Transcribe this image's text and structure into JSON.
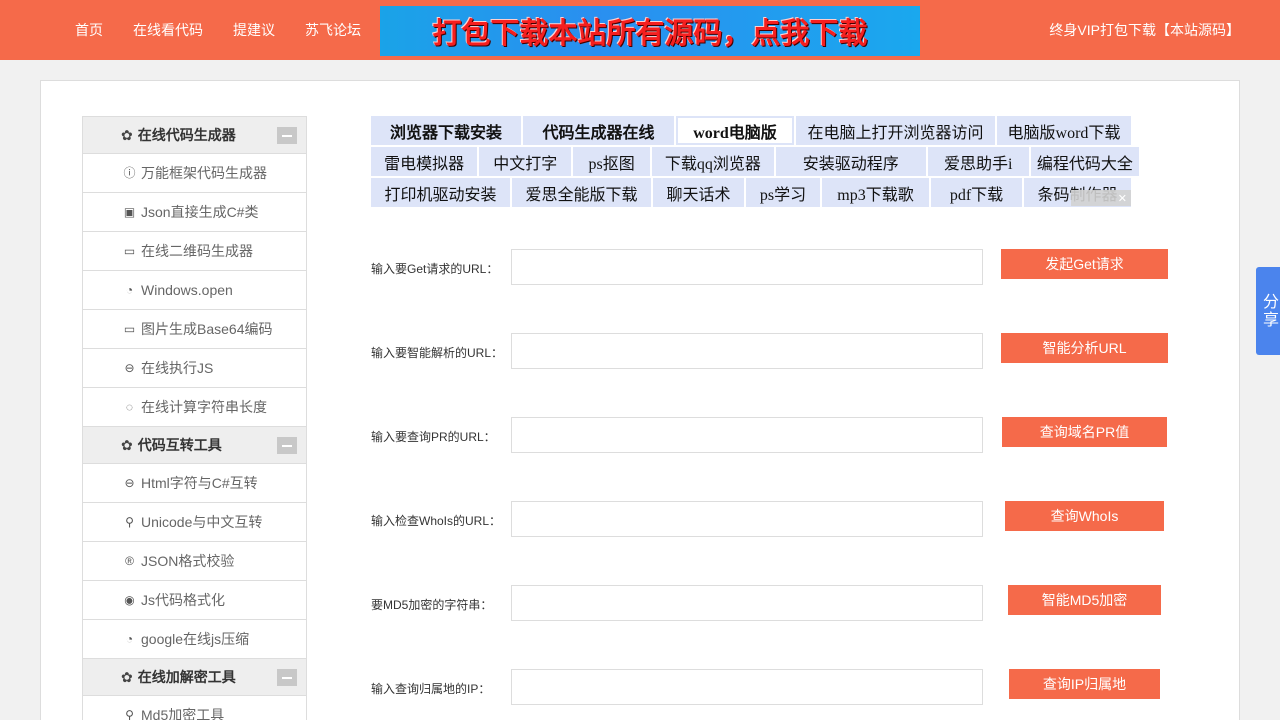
{
  "nav": {
    "items": [
      "首页",
      "在线看代码",
      "提建议",
      "苏飞论坛"
    ],
    "banner_text": "打包下载本站所有源码，点我下载",
    "vip_link": "终身VIP打包下载【本站源码】"
  },
  "colors": {
    "accent": "#f56a4a",
    "tag_bg": "#dde4f8",
    "share_bg": "#4b84ed"
  },
  "sidebar": {
    "groups": [
      {
        "title": "在线代码生成器",
        "items": [
          {
            "label": "万能框架代码生成器",
            "icon": "info-circle-icon"
          },
          {
            "label": "Json直接生成C#类",
            "icon": "image-icon"
          },
          {
            "label": "在线二维码生成器",
            "icon": "folder-icon"
          },
          {
            "label": "Windows.open",
            "icon": "clock-icon"
          },
          {
            "label": "图片生成Base64编码",
            "icon": "folder-icon"
          },
          {
            "label": "在线执行JS",
            "icon": "minus-circle-icon"
          },
          {
            "label": "在线计算字符串长度",
            "icon": "loading-icon"
          }
        ]
      },
      {
        "title": "代码互转工具",
        "items": [
          {
            "label": "Html字符与C#互转",
            "icon": "minus-circle-icon"
          },
          {
            "label": "Unicode与中文互转",
            "icon": "location-icon"
          },
          {
            "label": "JSON格式校验",
            "icon": "registered-icon"
          },
          {
            "label": "Js代码格式化",
            "icon": "eye-circle-icon"
          },
          {
            "label": "google在线js压缩",
            "icon": "clock-icon"
          }
        ]
      },
      {
        "title": "在线加解密工具",
        "items": [
          {
            "label": "Md5加密工具",
            "icon": "location-icon"
          }
        ]
      }
    ]
  },
  "tags": {
    "rows": [
      [
        {
          "label": "浏览器下载安装",
          "style": "bold"
        },
        {
          "label": "代码生成器在线",
          "style": "bold"
        },
        {
          "label": "word电脑版",
          "style": "active"
        },
        {
          "label": "在电脑上打开浏览器访问",
          "style": "normal"
        },
        {
          "label": "电脑版word下载",
          "style": "normal"
        }
      ],
      [
        {
          "label": "雷电模拟器",
          "style": "normal"
        },
        {
          "label": "中文打字",
          "style": "normal"
        },
        {
          "label": "ps抠图",
          "style": "normal"
        },
        {
          "label": "下载qq浏览器",
          "style": "normal"
        },
        {
          "label": "安装驱动程序",
          "style": "normal"
        },
        {
          "label": "爱思助手i",
          "style": "normal"
        },
        {
          "label": "编程代码大全",
          "style": "normal"
        }
      ],
      [
        {
          "label": "打印机驱动安装",
          "style": "normal"
        },
        {
          "label": "爱思全能版下载",
          "style": "normal"
        },
        {
          "label": "聊天话术",
          "style": "normal"
        },
        {
          "label": "ps学习",
          "style": "normal"
        },
        {
          "label": "mp3下载歌",
          "style": "normal"
        },
        {
          "label": "pdf下载",
          "style": "normal"
        },
        {
          "label": "条码制作器",
          "style": "normal"
        }
      ]
    ]
  },
  "tools": [
    {
      "label": "输入要Get请求的URL：",
      "value": "",
      "button": "发起Get请求"
    },
    {
      "label": "输入要智能解析的URL：",
      "value": "",
      "button": "智能分析URL"
    },
    {
      "label": "输入要查询PR的URL：",
      "value": "",
      "button": "查询域名PR值"
    },
    {
      "label": "输入检查WhoIs的URL：",
      "value": "",
      "button": "查询WhoIs"
    },
    {
      "label": "要MD5加密的字符串：",
      "value": "",
      "button": "智能MD5加密"
    },
    {
      "label": "输入查询归属地的IP：",
      "value": "",
      "button": "查询IP归属地"
    }
  ],
  "share": {
    "label": "分享"
  }
}
